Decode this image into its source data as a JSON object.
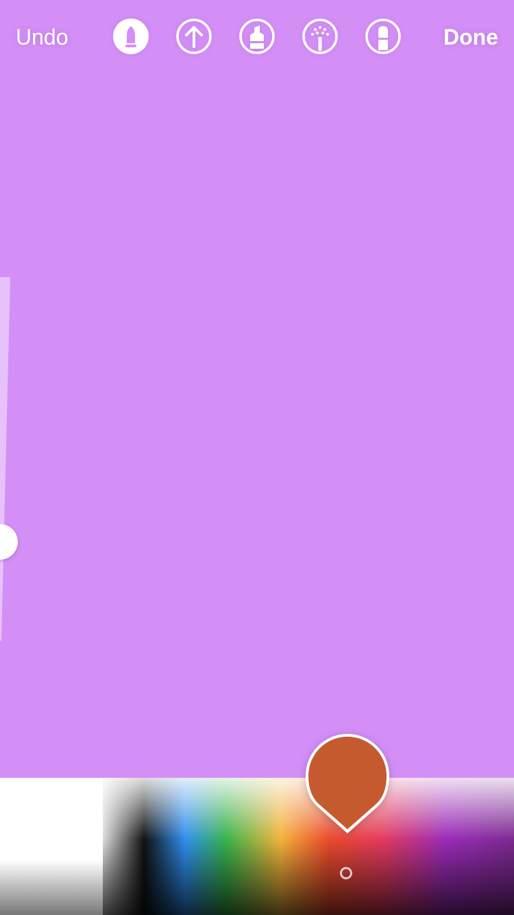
{
  "toolbar": {
    "undo_label": "Undo",
    "done_label": "Done",
    "tools": [
      {
        "name": "pen",
        "icon": "pen-tip-icon",
        "selected": true
      },
      {
        "name": "arrow",
        "icon": "arrow-up-icon",
        "selected": false
      },
      {
        "name": "marker",
        "icon": "marker-icon",
        "selected": false
      },
      {
        "name": "chalk",
        "icon": "chalk-brush-icon",
        "selected": false
      },
      {
        "name": "eraser",
        "icon": "eraser-icon",
        "selected": false
      }
    ]
  },
  "canvas": {
    "background_color": "#d48ff7"
  },
  "brush": {
    "selected_color": "#c55a2e"
  }
}
